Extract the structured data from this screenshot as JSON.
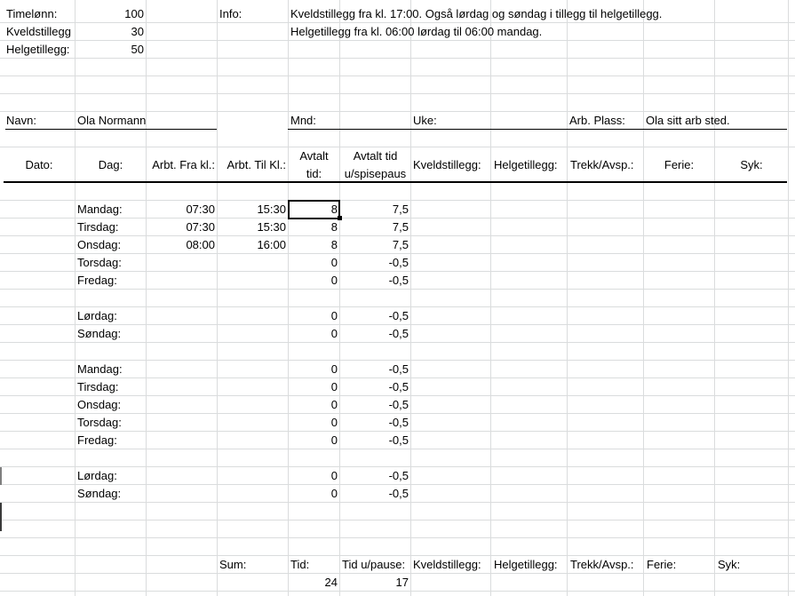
{
  "top": {
    "timelonn_label": "Timelønn:",
    "timelonn_value": "100",
    "kveld_label": "Kveldstillegg",
    "kveld_value": "30",
    "helg_label": "Helgetillegg:",
    "helg_value": "50",
    "info_label": "Info:",
    "info_line1": "Kveldstillegg fra kl. 17:00. Også lørdag og søndag i tillegg til helgetillegg.",
    "info_line2": "Helgetillegg fra kl. 06:00 lørdag til 06:00 mandag."
  },
  "meta": {
    "navn_label": "Navn:",
    "navn_value": "Ola Normann",
    "mnd_label": "Mnd:",
    "uke_label": "Uke:",
    "arb_plass_label": "Arb. Plass:",
    "arb_plass_value": "Ola sitt arb sted."
  },
  "headers": {
    "dato": "Dato:",
    "dag": "Dag:",
    "fra": "Arbt. Fra kl.:",
    "til": "Arbt. Til Kl.:",
    "avtalt_1": "Avtalt",
    "avtalt_2": "tid:",
    "avtalt_u_1": "Avtalt tid",
    "avtalt_u_2": "u/spisepaus",
    "kveld": "Kveldstillegg:",
    "helg": "Helgetillegg:",
    "trekk": "Trekk/Avsp.:",
    "ferie": "Ferie:",
    "syk": "Syk:"
  },
  "rows": [
    {
      "dag": "Mandag:",
      "fra": "07:30",
      "til": "15:30",
      "avtalt": "8",
      "avtalt_u": "7,5"
    },
    {
      "dag": "Tirsdag:",
      "fra": "07:30",
      "til": "15:30",
      "avtalt": "8",
      "avtalt_u": "7,5"
    },
    {
      "dag": "Onsdag:",
      "fra": "08:00",
      "til": "16:00",
      "avtalt": "8",
      "avtalt_u": "7,5"
    },
    {
      "dag": "Torsdag:",
      "fra": "",
      "til": "",
      "avtalt": "0",
      "avtalt_u": "-0,5"
    },
    {
      "dag": "Fredag:",
      "fra": "",
      "til": "",
      "avtalt": "0",
      "avtalt_u": "-0,5"
    },
    {
      "dag": "Lørdag:",
      "fra": "",
      "til": "",
      "avtalt": "0",
      "avtalt_u": "-0,5"
    },
    {
      "dag": "Søndag:",
      "fra": "",
      "til": "",
      "avtalt": "0",
      "avtalt_u": "-0,5"
    },
    {
      "dag": "Mandag:",
      "fra": "",
      "til": "",
      "avtalt": "0",
      "avtalt_u": "-0,5"
    },
    {
      "dag": "Tirsdag:",
      "fra": "",
      "til": "",
      "avtalt": "0",
      "avtalt_u": "-0,5"
    },
    {
      "dag": "Onsdag:",
      "fra": "",
      "til": "",
      "avtalt": "0",
      "avtalt_u": "-0,5"
    },
    {
      "dag": "Torsdag:",
      "fra": "",
      "til": "",
      "avtalt": "0",
      "avtalt_u": "-0,5"
    },
    {
      "dag": "Fredag:",
      "fra": "",
      "til": "",
      "avtalt": "0",
      "avtalt_u": "-0,5"
    },
    {
      "dag": "Lørdag:",
      "fra": "",
      "til": "",
      "avtalt": "0",
      "avtalt_u": "-0,5"
    },
    {
      "dag": "Søndag:",
      "fra": "",
      "til": "",
      "avtalt": "0",
      "avtalt_u": "-0,5"
    }
  ],
  "footer": {
    "sum_label": "Sum:",
    "tid_label": "Tid:",
    "tid_u_label": "Tid u/pause:",
    "kveld": "Kveldstillegg:",
    "helg": "Helgetillegg:",
    "trekk": "Trekk/Avsp.:",
    "ferie": "Ferie:",
    "syk": "Syk:",
    "tid_value": "24",
    "tid_u_value": "17"
  }
}
